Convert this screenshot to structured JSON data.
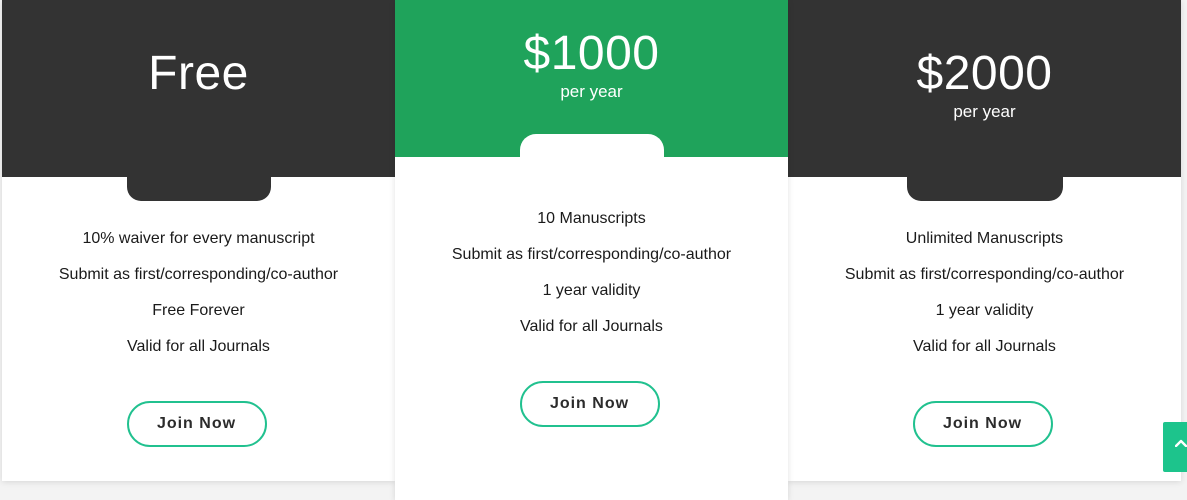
{
  "plans": [
    {
      "price": "Free",
      "period": "",
      "features": [
        "10% waiver for every manuscript",
        "Submit as first/corresponding/co-author",
        "Free Forever",
        "Valid for all Journals"
      ],
      "button_label": "Join Now"
    },
    {
      "price": "$1000",
      "period": "per year",
      "features": [
        "10 Manuscripts",
        "Submit as first/corresponding/co-author",
        "1 year validity",
        "Valid for all Journals"
      ],
      "button_label": "Join Now"
    },
    {
      "price": "$2000",
      "period": "per year",
      "features": [
        "Unlimited Manuscripts",
        "Submit as first/corresponding/co-author",
        "1 year validity",
        "Valid for all Journals"
      ],
      "button_label": "Join Now"
    }
  ],
  "colors": {
    "dark_header": "#333333",
    "featured_header": "#1fa35b",
    "button_border": "#21c18f",
    "scroll_button": "#1dc48c"
  },
  "icons": {
    "scroll_top": "chevron-up-icon"
  }
}
